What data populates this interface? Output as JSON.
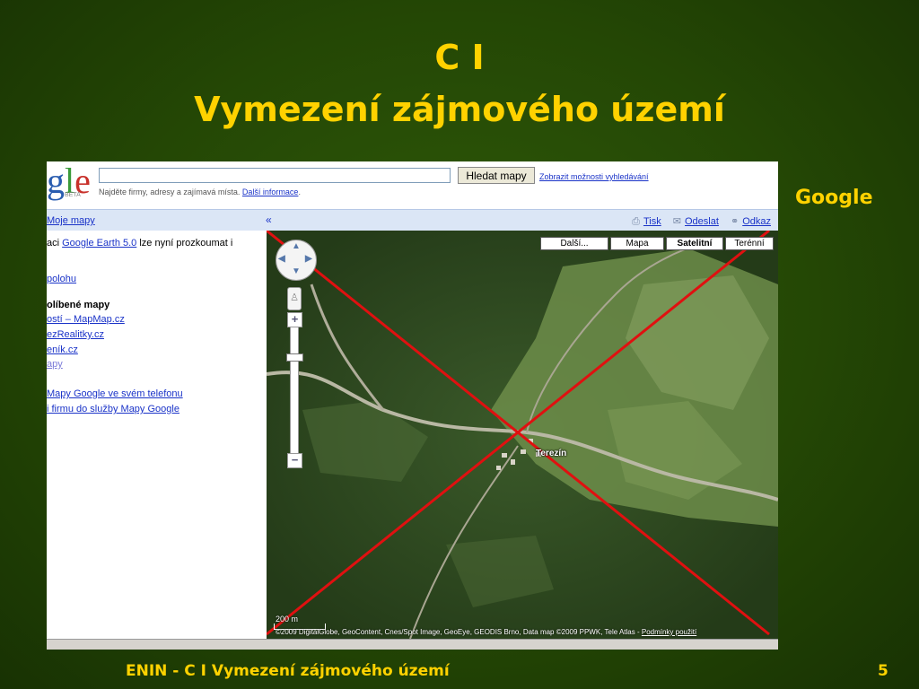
{
  "slide": {
    "title_line1": "C I",
    "title_line2": "Vymezení zájmového území",
    "side_label": "Google",
    "footer_text": "ENIN - C I Vymezení zájmového území",
    "page_number": "5",
    "title_color": "#ffd200",
    "background_color": "#244705"
  },
  "screenshot": {
    "logo_text": "gle",
    "logo_beta": "BETA",
    "search": {
      "value": "",
      "button_label": "Hledat mapy",
      "options_link": "Zobrazit možnosti vyhledávání"
    },
    "hint_text": "Najděte firmy, adresy a zajímavá místa.",
    "hint_link": "Další informace",
    "navbar": {
      "my_maps": "Moje mapy",
      "collapse": "«",
      "print": "Tisk",
      "send": "Odeslat",
      "link": "Odkaz"
    },
    "left_panel": {
      "line1_prefix": "aci",
      "line1_link": "Google Earth 5.0",
      "line1_suffix": "lze nyní prozkoumat i",
      "location_link": "polohu",
      "favorites_heading": "olíbené mapy",
      "fav1": "ostí – MapMap.cz",
      "fav2": "ezRealitky.cz",
      "fav3": "eník.cz",
      "fav4": "apy",
      "phone_link": "Mapy Google ve svém telefonu",
      "business_link": "i firmu do služby Mapy Google"
    },
    "map": {
      "types": {
        "more": "Další...",
        "map": "Mapa",
        "satellite": "Satelitní",
        "terrain": "Terénní"
      },
      "selected_type": "Satelitní",
      "place_label": "Terezín",
      "scale_text": "200 m",
      "attribution": "©2009 DigitalGlobe, GeoContent, Cnes/Spot Image, GeoEye, GEODIS Brno, Data map ©2009 PPWK, Tele Atlas -",
      "terms_link": "Podmínky použití",
      "cross_color": "#e01010"
    }
  }
}
